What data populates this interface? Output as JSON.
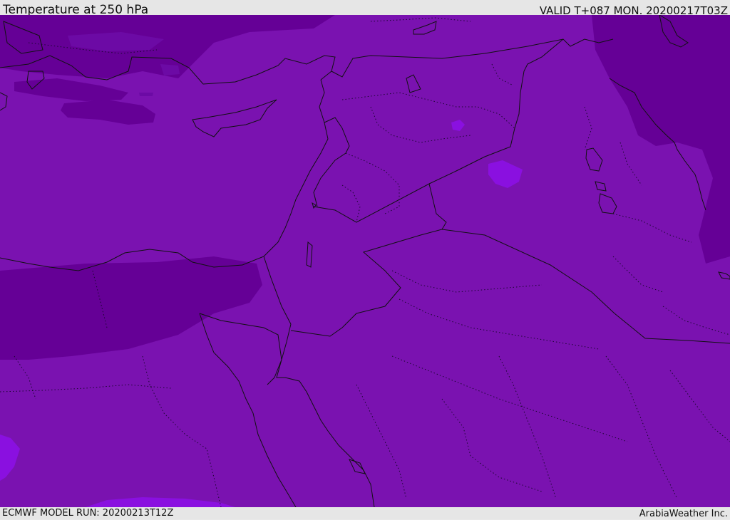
{
  "header": {
    "title": "Temperature at 250 hPa",
    "valid": "VALID T+087 MON. 20200217T03Z"
  },
  "footer": {
    "model_run": "ECMWF MODEL RUN: 20200213T12Z",
    "credit": "ArabiaWeather Inc."
  },
  "colors": {
    "base": "#7a12b0",
    "colder": "#650096",
    "warmer": "#8a10e0",
    "outline": "#111111"
  }
}
